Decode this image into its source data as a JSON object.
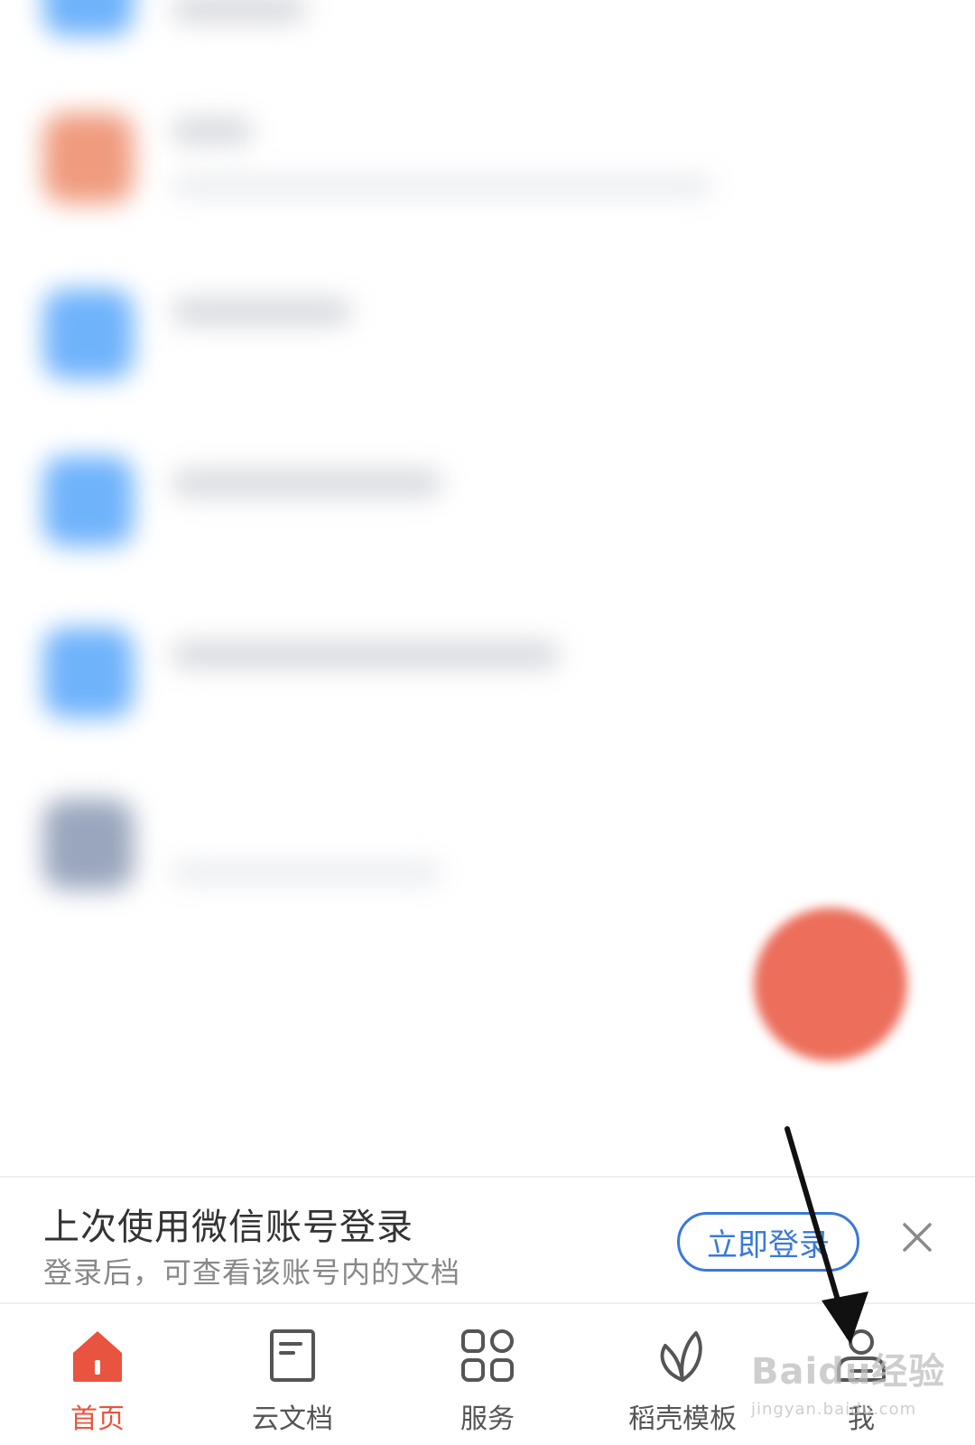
{
  "banner": {
    "title": "上次使用微信账号登录",
    "subtitle": "登录后，可查看该账号内的文档",
    "login_label": "立即登录",
    "close_icon": "close-icon"
  },
  "nav": {
    "items": [
      {
        "label": "首页",
        "icon": "home-icon",
        "active": true
      },
      {
        "label": "云文档",
        "icon": "document-icon",
        "active": false
      },
      {
        "label": "服务",
        "icon": "apps-grid-icon",
        "active": false
      },
      {
        "label": "稻壳模板",
        "icon": "leaf-icon",
        "active": false
      },
      {
        "label": "我",
        "icon": "user-icon",
        "active": false
      }
    ]
  },
  "watermark": {
    "main": "Baidu经验",
    "sub": "jingyan.baidu.com"
  },
  "colors": {
    "accent": "#e8543f",
    "link": "#3a79d8",
    "fab": "#ec6e5b",
    "row_icon_blue": "#6fb3fb",
    "row_icon_orange": "#f09b7e",
    "row_icon_gray": "#9aa6bd"
  }
}
